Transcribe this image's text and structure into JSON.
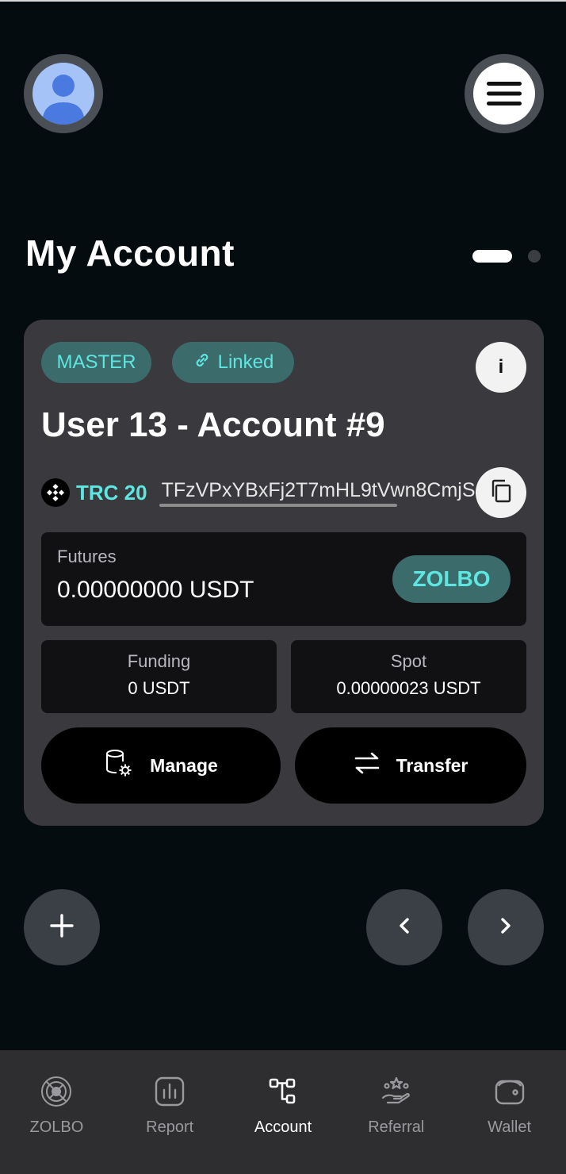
{
  "header": {
    "avatar_icon": "user-avatar-icon",
    "menu_icon": "hamburger-menu-icon"
  },
  "page": {
    "title": "My Account",
    "pager_total": 2,
    "pager_active": 1
  },
  "card": {
    "chip_master": "MASTER",
    "chip_linked": "Linked",
    "info_label": "i",
    "account_name": "User 13 - Account #9",
    "network": "TRC 20",
    "address": "TFzVPxYBxFj2T7mHL9tVwn8CmjS",
    "futures": {
      "label": "Futures",
      "value": "0.00000000 USDT",
      "badge": "ZOLBO"
    },
    "funding": {
      "label": "Funding",
      "value": "0 USDT"
    },
    "spot": {
      "label": "Spot",
      "value": "0.00000023 USDT"
    },
    "manage_label": "Manage",
    "transfer_label": "Transfer"
  },
  "nav": {
    "items": [
      {
        "label": "ZOLBO",
        "icon": "zolbo-logo-icon",
        "active": false
      },
      {
        "label": "Report",
        "icon": "bar-chart-icon",
        "active": false
      },
      {
        "label": "Account",
        "icon": "account-tree-icon",
        "active": true
      },
      {
        "label": "Referral",
        "icon": "referral-hand-icon",
        "active": false
      },
      {
        "label": "Wallet",
        "icon": "wallet-icon",
        "active": false
      }
    ]
  },
  "colors": {
    "background": "#050c10",
    "card": "#3a393e",
    "accent": "#5ee6e0",
    "chip": "#3c6b6c",
    "nav_bg": "#2e2e30"
  }
}
